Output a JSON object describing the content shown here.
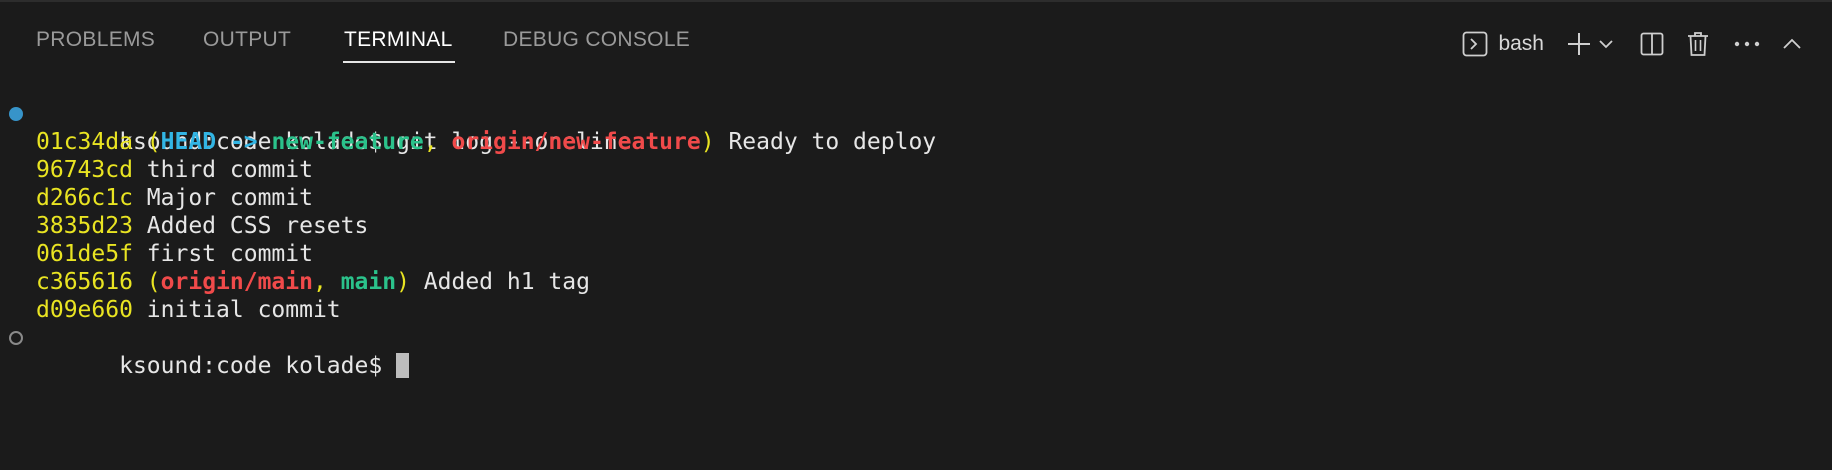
{
  "tabs": [
    {
      "label": "PROBLEMS",
      "active": false
    },
    {
      "label": "OUTPUT",
      "active": false
    },
    {
      "label": "TERMINAL",
      "active": true
    },
    {
      "label": "DEBUG CONSOLE",
      "active": false
    }
  ],
  "toolbar": {
    "shell_icon": "terminal-icon",
    "shell_label": "bash",
    "new_terminal_icon": "plus-icon",
    "dropdown_icon": "chevron-down-icon",
    "split_icon": "split-editor-icon",
    "kill_icon": "trash-icon",
    "more_icon": "ellipsis-icon",
    "maximize_icon": "chevron-up-icon"
  },
  "terminal": {
    "prompt": "ksound:code kolade$",
    "command": " git log --oneline",
    "log": [
      {
        "hash": "01c34da",
        "refs": [
          {
            "text": "HEAD -> ",
            "kind": "head"
          },
          {
            "text": "new-feature",
            "kind": "local"
          },
          {
            "text": ", ",
            "kind": "sep"
          },
          {
            "text": "origin/new-feature",
            "kind": "remote"
          }
        ],
        "message": "Ready to deploy"
      },
      {
        "hash": "96743cd",
        "refs": [],
        "message": "third commit"
      },
      {
        "hash": "d266c1c",
        "refs": [],
        "message": "Major commit"
      },
      {
        "hash": "3835d23",
        "refs": [],
        "message": "Added CSS resets"
      },
      {
        "hash": "061de5f",
        "refs": [],
        "message": "first commit"
      },
      {
        "hash": "c365616",
        "refs": [
          {
            "text": "origin/main",
            "kind": "remote"
          },
          {
            "text": ", ",
            "kind": "sep"
          },
          {
            "text": "main",
            "kind": "local"
          }
        ],
        "message": "Added h1 tag"
      },
      {
        "hash": "d09e660",
        "refs": [],
        "message": "initial commit"
      }
    ]
  },
  "colors": {
    "background": "#1b1b1b",
    "hash": "#e9e422",
    "head": "#32b5e4",
    "local_branch": "#2bc28b",
    "remote_branch": "#f04a4a",
    "success_marker": "#3794c9"
  }
}
